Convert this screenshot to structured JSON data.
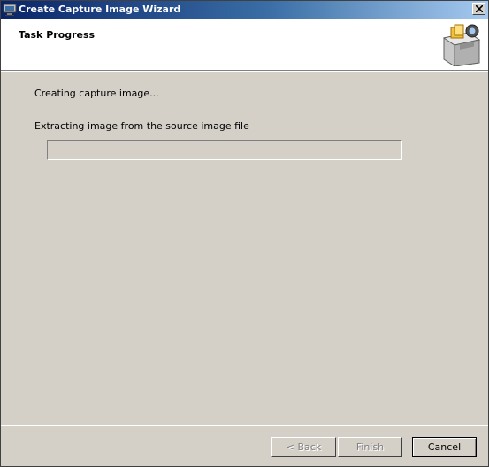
{
  "window": {
    "title": "Create Capture Image Wizard",
    "close_symbol": "×"
  },
  "header": {
    "title": "Task Progress",
    "art_icon": "file-cabinet-icon"
  },
  "main": {
    "status": "Creating capture image...",
    "detail": "Extracting image from the source image file",
    "progress_fraction": 0
  },
  "footer": {
    "back_label": "< Back",
    "finish_label": "Finish",
    "cancel_label": "Cancel"
  },
  "colors": {
    "title_start": "#0a246a",
    "title_end": "#a6caf0",
    "face": "#d4d0c8"
  }
}
